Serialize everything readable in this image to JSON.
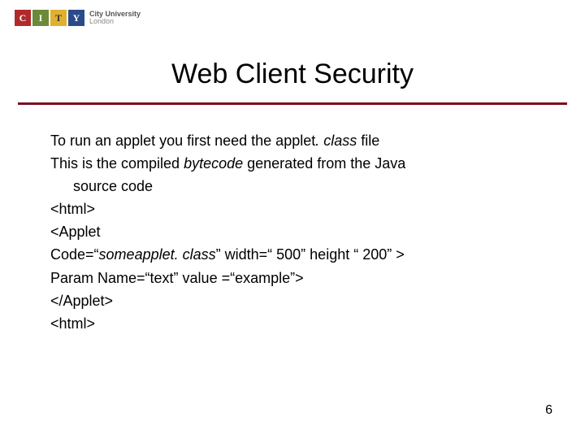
{
  "logo": {
    "letters": [
      "C",
      "I",
      "T",
      "Y"
    ],
    "text_line1": "City University",
    "text_line2": "London"
  },
  "title": "Web Client Security",
  "body": {
    "l1a": "To run an applet you first need the applet",
    "l1b": ". class",
    "l1c": " file",
    "l2a": "This is the compiled ",
    "l2b": "bytecode",
    "l2c": " generated from the Java",
    "l2d": "source code",
    "l3": "<html>",
    "l4": "<Applet",
    "l5a": "Code=“",
    "l5b": "someapplet. class",
    "l5c": "” width=“ 500” height “ 200” >",
    "l6": "Param Name=“text” value =“example”>",
    "l7": "</Applet>",
    "l8": "<html>"
  },
  "page_number": "6"
}
